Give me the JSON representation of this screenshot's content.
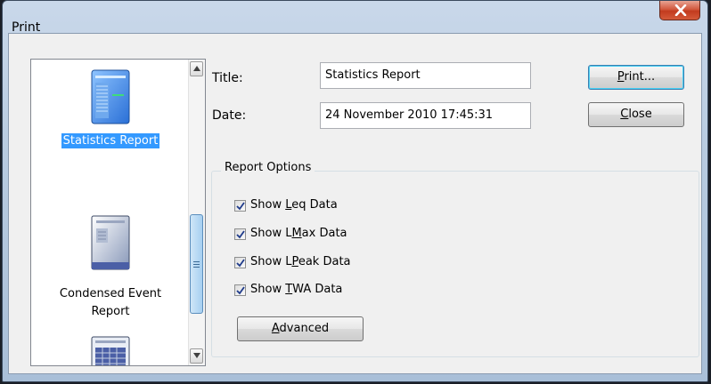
{
  "window": {
    "title": "Print",
    "close_icon": "close-x-icon"
  },
  "report_list": {
    "items": [
      {
        "label": "Statistics Report",
        "icon": "statistics-report-icon",
        "selected": true
      },
      {
        "label_line1": "Condensed Event",
        "label_line2": "Report",
        "icon": "condensed-event-report-icon",
        "selected": false
      },
      {
        "label": "",
        "icon": "grid-report-icon",
        "selected": false
      }
    ]
  },
  "form": {
    "title_label": "Title:",
    "title_value": "Statistics Report",
    "date_label": "Date:",
    "date_value": "24 November 2010 17:45:31"
  },
  "buttons": {
    "print_mnemonic": "P",
    "print_rest": "rint...",
    "close_mnemonic": "C",
    "close_rest": "lose",
    "advanced_mnemonic": "A",
    "advanced_rest": "dvanced"
  },
  "report_options": {
    "title": "Report Options",
    "options": [
      {
        "pre": "Show ",
        "mnemonic": "L",
        "post": "eq Data",
        "checked": true
      },
      {
        "pre": "Show L",
        "mnemonic": "M",
        "post": "ax Data",
        "checked": true
      },
      {
        "pre": "Show L",
        "mnemonic": "P",
        "post": "eak Data",
        "checked": true
      },
      {
        "pre": "Show ",
        "mnemonic": "T",
        "post": "WA Data",
        "checked": true
      }
    ]
  }
}
